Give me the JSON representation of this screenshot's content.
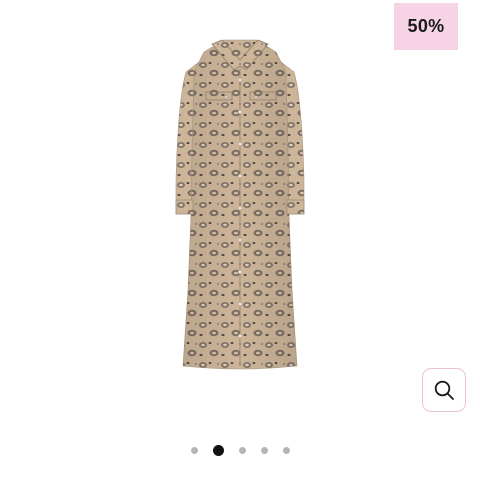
{
  "badge": {
    "label": "50%",
    "color": "#f7d3e6"
  },
  "product": {
    "image_icon": "leopard-print-shirt-dress"
  },
  "zoom": {
    "icon": "magnifier-icon",
    "border_color": "#ecc3d3"
  },
  "pagination": {
    "count": 5,
    "active_index": 1
  }
}
